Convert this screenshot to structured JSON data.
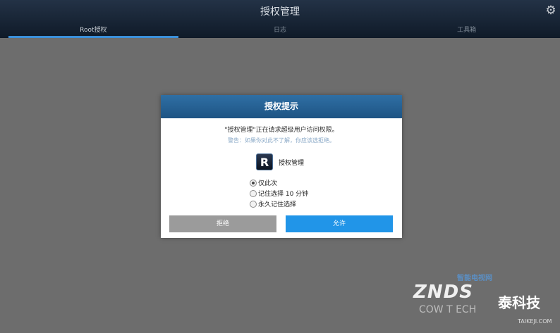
{
  "appbar": {
    "title": "授权管理",
    "settings_icon": "gear-icon",
    "tabs": [
      {
        "label": "Root授权",
        "active": true
      },
      {
        "label": "日志",
        "active": false
      },
      {
        "label": "工具箱",
        "active": false
      }
    ]
  },
  "dialog": {
    "title": "授权提示",
    "message": "\"授权管理\"正在请求超级用户访问权限。",
    "warning": "警告：如果你对此不了解，你应该选拒绝。",
    "app_icon_letter": "R",
    "app_name": "授权管理",
    "options": [
      {
        "label": "仅此次",
        "checked": true
      },
      {
        "label": "记住选择 10 分钟",
        "checked": false
      },
      {
        "label": "永久记住选择",
        "checked": false
      }
    ],
    "deny_label": "拒绝",
    "allow_label": "允许"
  },
  "watermark": {
    "line1": "智能电视网",
    "line2": "ZNDS",
    "line3": "泰科技",
    "line4": "COW T ECH",
    "line5": "TAIKEJI.COM"
  },
  "colors": {
    "accent": "#2195e8",
    "header": "#1e5484",
    "background": "#6d6d6d"
  }
}
